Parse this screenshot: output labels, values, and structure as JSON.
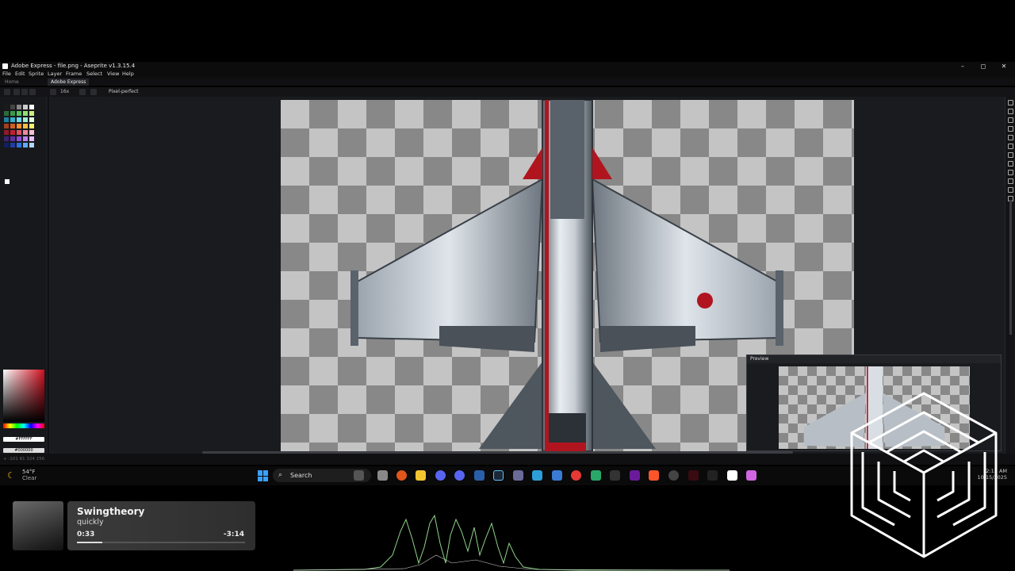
{
  "window": {
    "title": "Adobe Express - file.png - Aseprite v1.3.15.4",
    "minimize_glyph": "–",
    "maximize_glyph": "◻",
    "close_glyph": "✕"
  },
  "menu": {
    "file": "File",
    "edit": "Edit",
    "sprite": "Sprite",
    "layer": "Layer",
    "frame": "Frame",
    "select": "Select",
    "view": "View",
    "help": "Help"
  },
  "tabs": {
    "home": "Home",
    "doc": "Adobe Express"
  },
  "toolbar": {
    "mode_label": "Pixel-perfect",
    "zoom_label": "16x"
  },
  "palette": {
    "colors": [
      "#1a1a1a",
      "#444",
      "#888",
      "#ccc",
      "#ffffff",
      "#2a6b3a",
      "#3a9a4a",
      "#55c060",
      "#8fe070",
      "#c8f080",
      "#1f7fa0",
      "#36b0c8",
      "#70d8e8",
      "#a0f0d0",
      "#e0ffe0",
      "#a04020",
      "#d06020",
      "#f09030",
      "#f8c040",
      "#fff070",
      "#901828",
      "#c02030",
      "#e05060",
      "#f088a0",
      "#ffc0d0",
      "#402070",
      "#6030a0",
      "#9050d0",
      "#c080f0",
      "#e8c0ff",
      "#102060",
      "#2040a0",
      "#3070e0",
      "#60a8ff",
      "#b0d8ff"
    ]
  },
  "color": {
    "fg_hex": "#FFFFFF",
    "bg_hex": "#000000"
  },
  "preview": {
    "title": "Preview"
  },
  "statusbar": {
    "coords": "+ -101 81   324 256"
  },
  "taskbar": {
    "weather_temp": "54°F",
    "weather_desc": "Clear",
    "search_placeholder": "Search",
    "clock_time": "2:15 AM",
    "clock_date": "10/15/2025"
  },
  "media": {
    "title": "Swingtheory",
    "artist": "quickly",
    "current_time": "0:33",
    "remaining_time": "-3:14",
    "progress": 0.15
  }
}
